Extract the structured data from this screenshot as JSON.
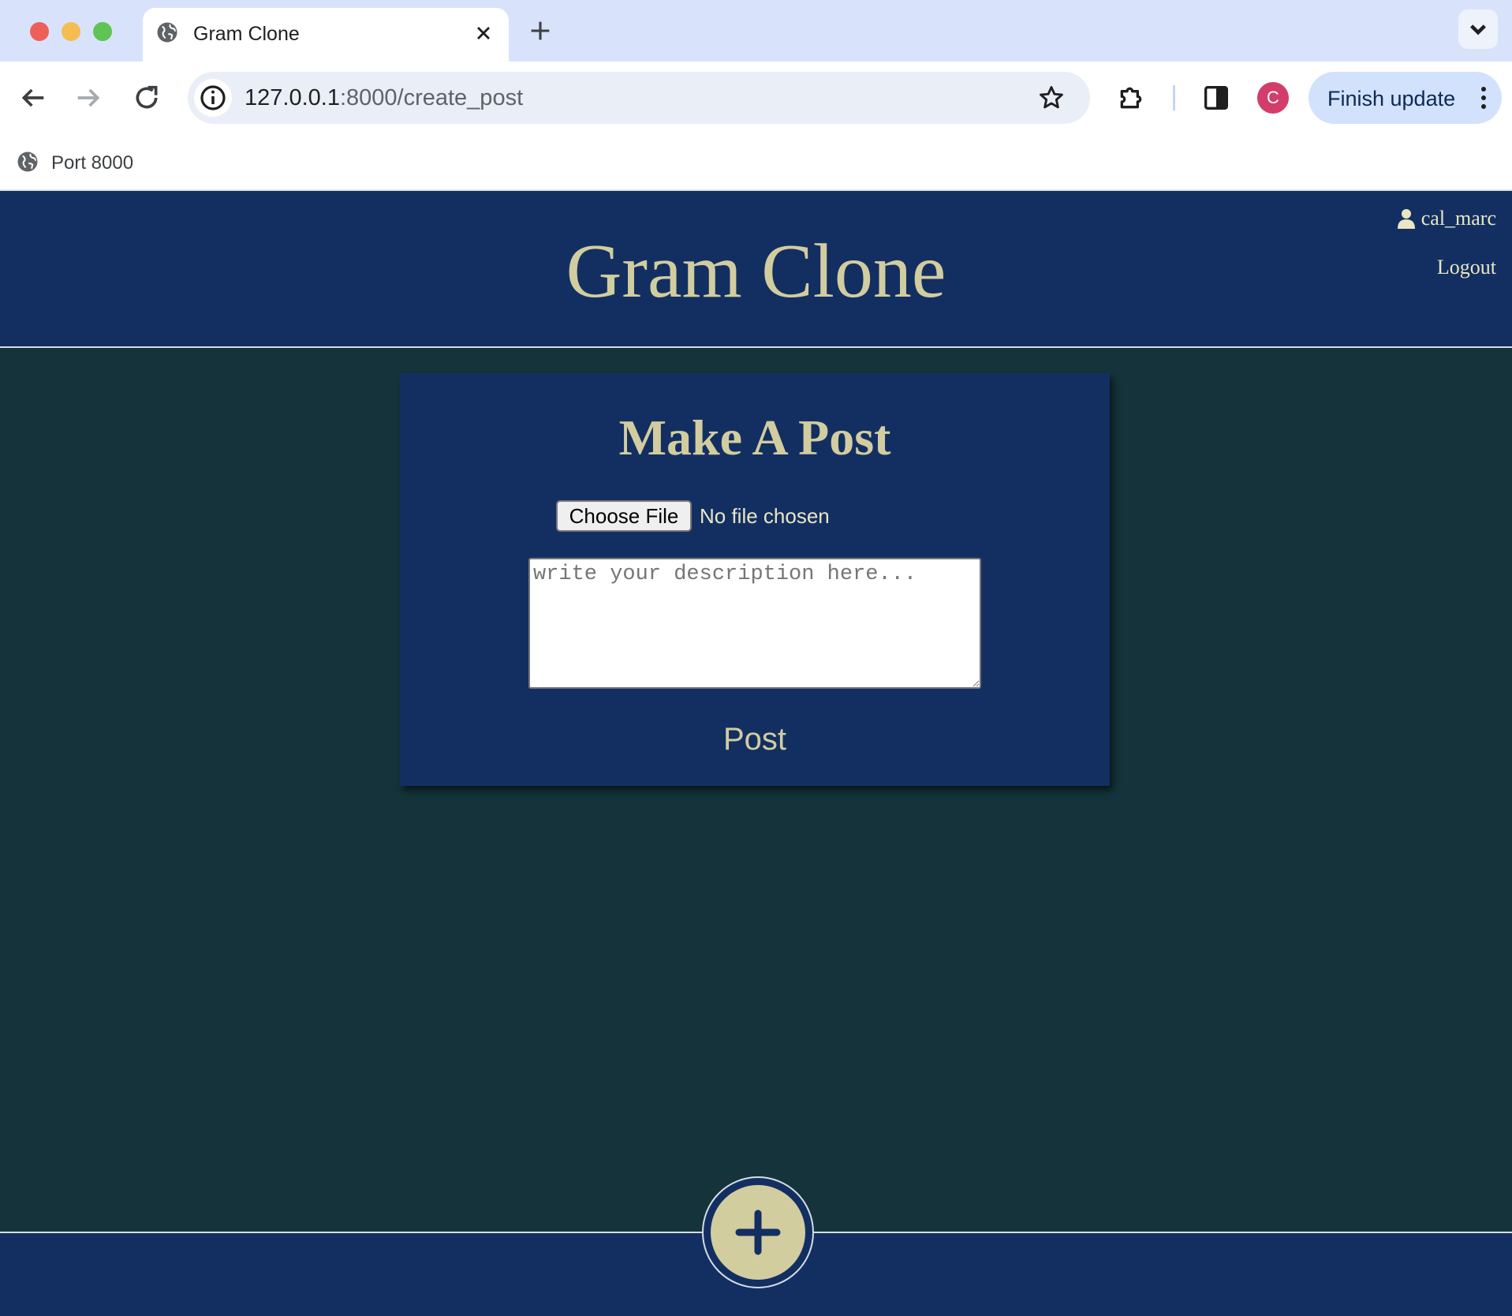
{
  "browser": {
    "tab": {
      "title": "Gram Clone",
      "favicon": "globe-icon"
    },
    "url": {
      "host": "127.0.0.1",
      "rest": ":8000/create_post"
    },
    "profile_initial": "C",
    "finish_update_label": "Finish update",
    "bookmarks": [
      {
        "label": "Port 8000",
        "icon": "globe-icon"
      }
    ]
  },
  "header": {
    "site_title": "Gram Clone",
    "username": "cal_marc",
    "logout_label": "Logout"
  },
  "post_form": {
    "title": "Make A Post",
    "choose_file_label": "Choose File",
    "file_status": "No file chosen",
    "description_placeholder": "write your description here...",
    "description_value": "",
    "submit_label": "Post"
  },
  "footer": {
    "add_icon": "plus-icon"
  },
  "colors": {
    "header_bg": "#132f62",
    "page_bg": "#14333a",
    "accent_text": "#d2cd9f",
    "fab_bg": "#d2cd9f"
  }
}
